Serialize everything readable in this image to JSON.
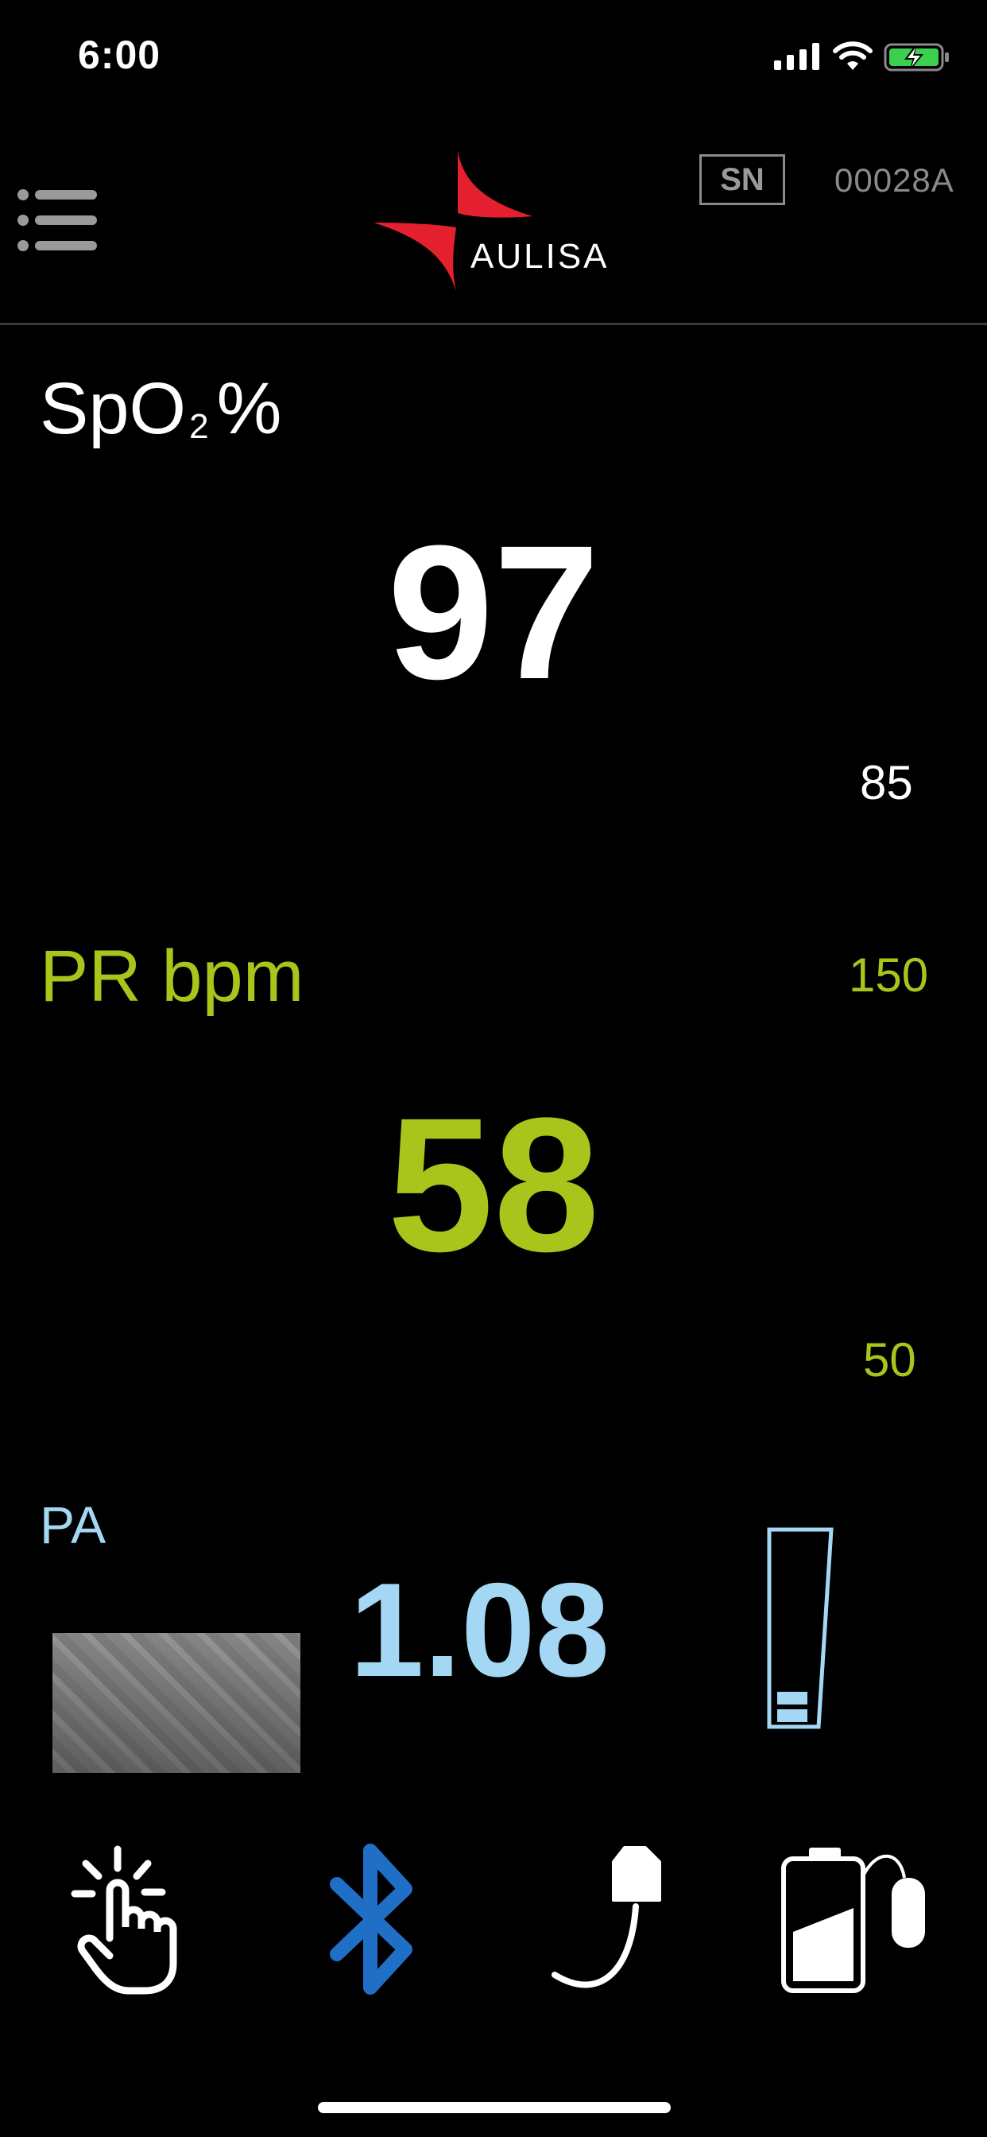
{
  "status_bar": {
    "time": "6:00",
    "icons": [
      "signal-icon",
      "wifi-icon",
      "battery-charging-icon"
    ]
  },
  "header": {
    "menu_icon": "hamburger-menu-icon",
    "brand": "AULISA",
    "sn_label": "SN",
    "serial_number": "00028A"
  },
  "spo2": {
    "label_main": "SpO",
    "label_sub": "2",
    "label_unit": "%",
    "value": "97",
    "low_limit": "85"
  },
  "pr": {
    "label": "PR bpm",
    "value": "58",
    "high_limit": "150",
    "low_limit": "50"
  },
  "pa": {
    "label": "PA",
    "value": "1.08",
    "bar_level_segments": 2
  },
  "bottom_bar": {
    "icons": [
      "touch-icon",
      "bluetooth-icon",
      "sensor-icon",
      "battery-sensor-icon"
    ]
  },
  "colors": {
    "pr": "#a9c51b",
    "pa": "#a3d7f3",
    "brand_red": "#e5202e",
    "bluetooth": "#1f6fc7"
  }
}
